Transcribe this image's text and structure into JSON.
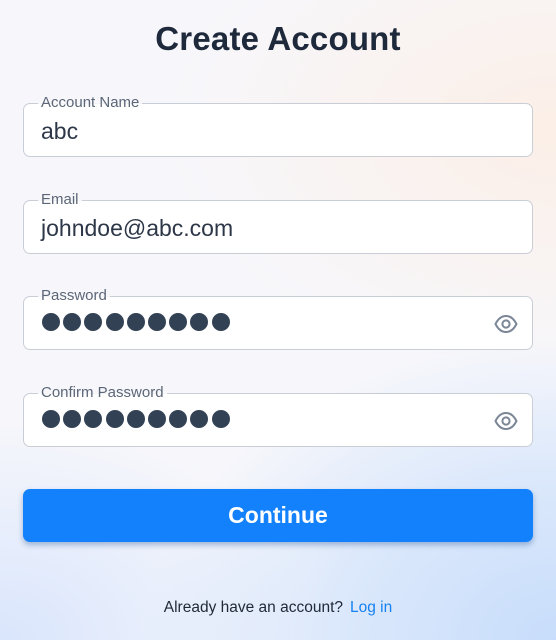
{
  "title": "Create Account",
  "fields": {
    "account_name": {
      "label": "Account Name",
      "value": "abc"
    },
    "email": {
      "label": "Email",
      "value": "johndoe@abc.com"
    },
    "password": {
      "label": "Password",
      "masked_length": 9,
      "icon": "eye-icon"
    },
    "confirm_password": {
      "label": "Confirm Password",
      "masked_length": 9,
      "icon": "eye-icon"
    }
  },
  "continue_label": "Continue",
  "footer": {
    "prompt": "Already have an account?",
    "link": "Log in"
  },
  "colors": {
    "accent": "#1381fc",
    "link": "#1681f0",
    "title": "#1e293b"
  }
}
